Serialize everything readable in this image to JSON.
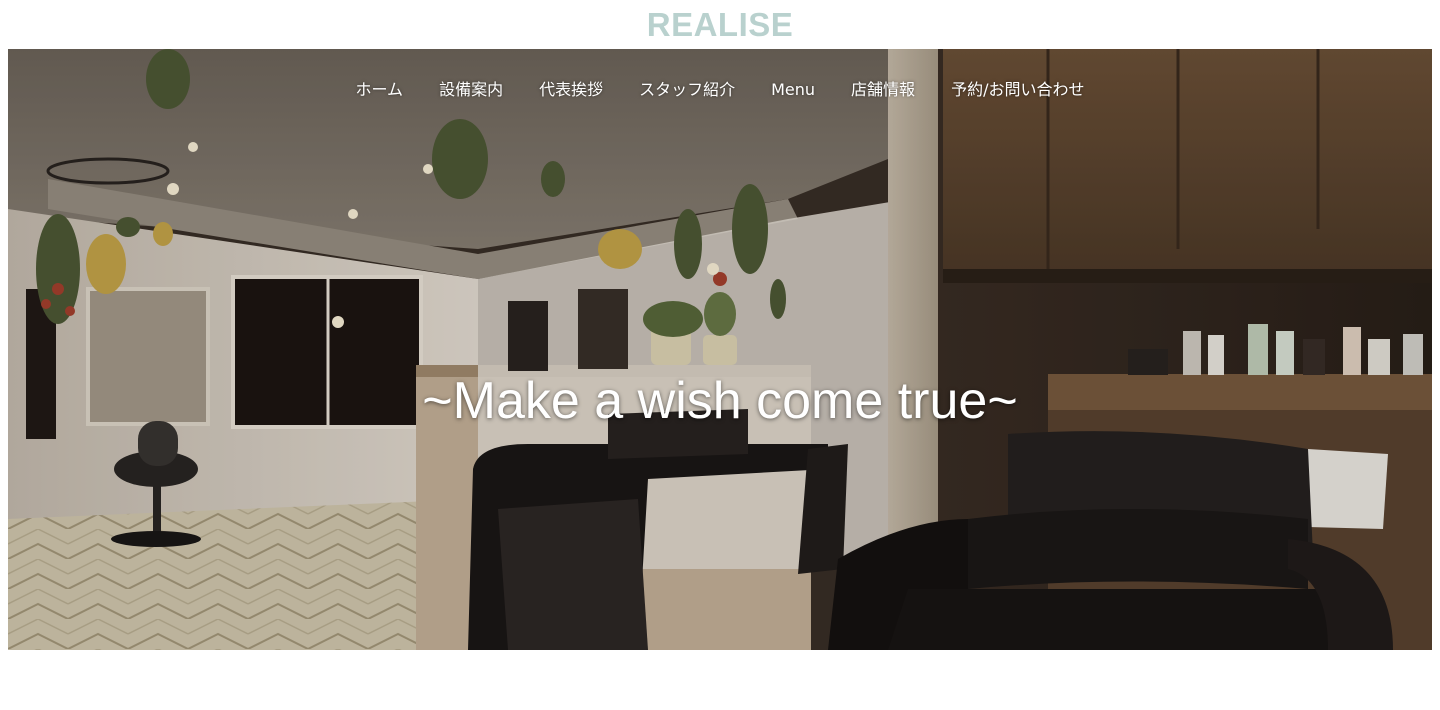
{
  "brand": {
    "logo_text": "REALISE",
    "logo_color": "#b9d1ce"
  },
  "nav": {
    "items": [
      {
        "label": "ホーム"
      },
      {
        "label": "設備案内"
      },
      {
        "label": "代表挨拶"
      },
      {
        "label": "スタッフ紹介"
      },
      {
        "label": "Menu"
      },
      {
        "label": "店舗情報"
      },
      {
        "label": "予約/お問い合わせ"
      }
    ]
  },
  "hero": {
    "tagline": "~Make a wish come true~",
    "image_icon": "salon-interior-photo"
  }
}
